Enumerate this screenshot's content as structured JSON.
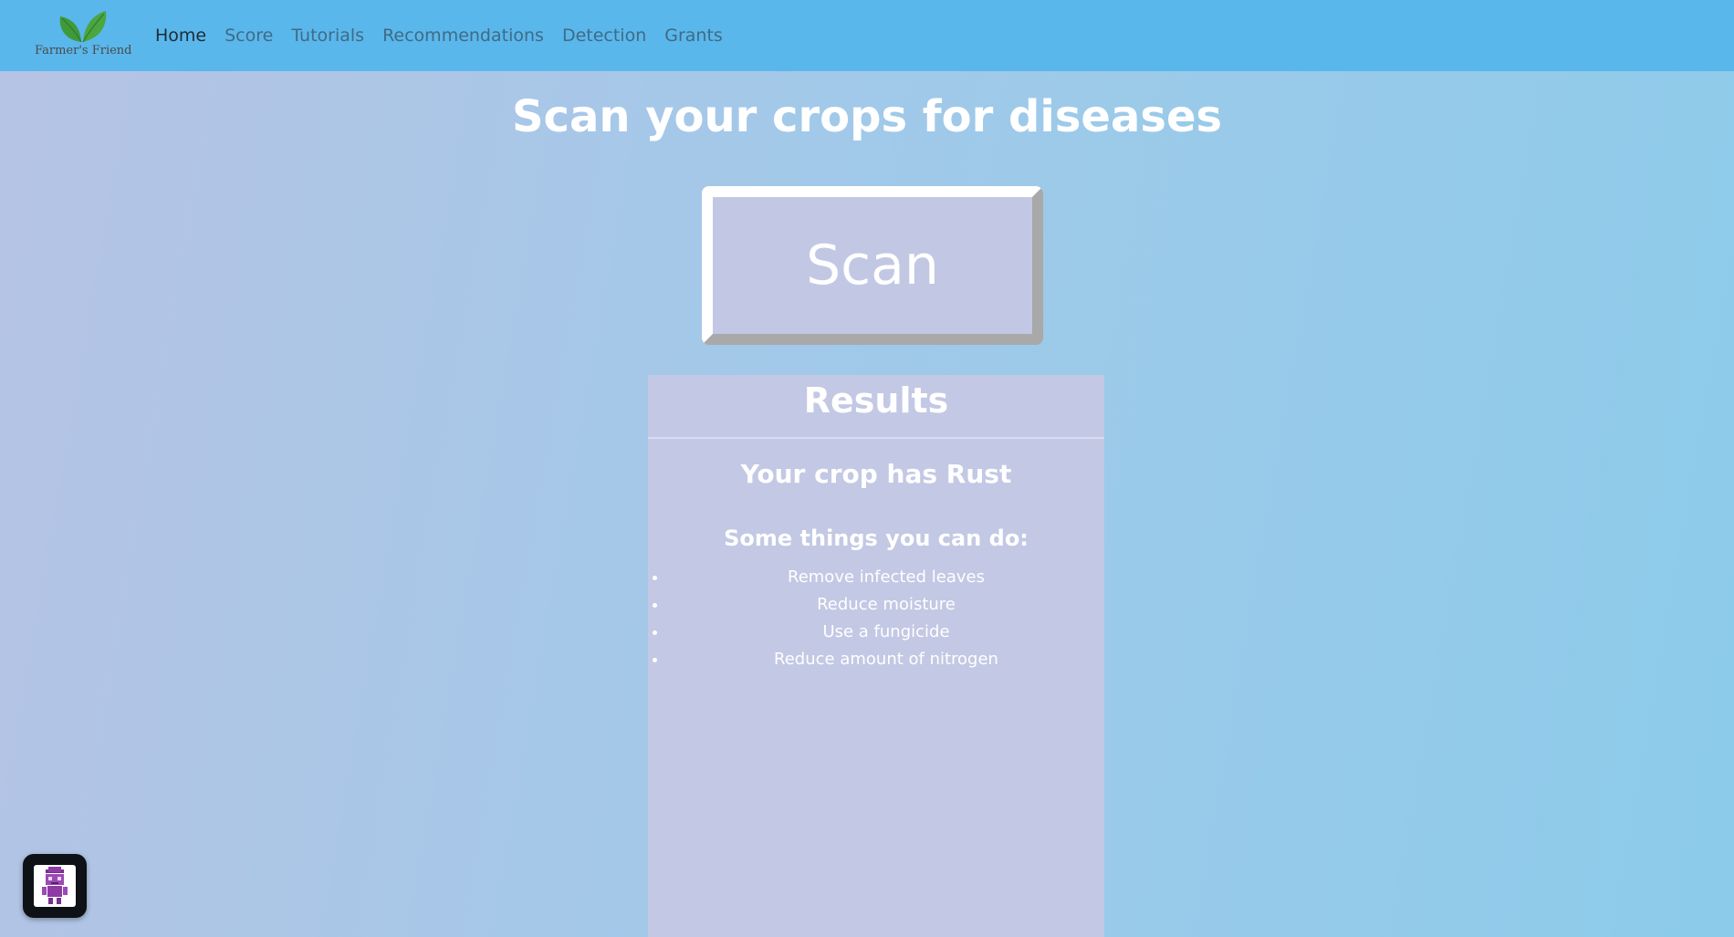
{
  "nav": {
    "brand": "Farmer's Friend",
    "logo_icon": "leaf-icon",
    "links": [
      "Home",
      "Score",
      "Tutorials",
      "Recommendations",
      "Detection",
      "Grants"
    ],
    "active": "Home"
  },
  "page": {
    "title": "Scan your crops for diseases"
  },
  "scan_button": {
    "label": "Scan"
  },
  "results": {
    "title": "Results",
    "diagnosis": "Your crop has Rust",
    "advice_heading": "Some things you can do:",
    "advice": [
      "Remove infected leaves",
      "Reduce moisture",
      "Use a fungicide",
      "Reduce amount of nitrogen"
    ]
  },
  "chat_widget": {
    "icon": "robot-avatar-icon"
  },
  "colors": {
    "navbar": "#5ab7eb",
    "panel": "#c3c8e4",
    "leaf": "#3f9a3a"
  }
}
